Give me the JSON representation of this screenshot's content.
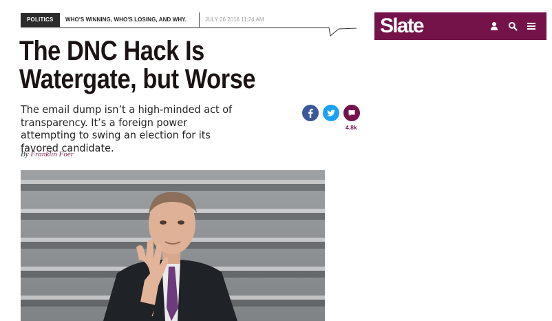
{
  "kicker": {
    "section": "POLITICS",
    "series": "WHO'S WINNING, WHO'S LOSING, AND WHY.",
    "date": "JULY 26 2016 11:24 AM"
  },
  "article": {
    "headline_line1": "The DNC Hack Is",
    "headline_line2": "Watergate, but Worse",
    "dek": "The email dump isn’t a high-minded act of transparency. It’s a foreign power attempting to swing an election for its favored candidate.",
    "byline_prefix": "By",
    "author": "Franklin Foer"
  },
  "social": {
    "facebook_icon": "facebook-icon",
    "twitter_icon": "twitter-icon",
    "comments_icon": "comment-icon",
    "comment_count": "4.8k"
  },
  "header": {
    "logo": "Slate",
    "brand_color": "#74134a",
    "icons": [
      "user-icon",
      "search-icon",
      "menu-icon"
    ]
  }
}
